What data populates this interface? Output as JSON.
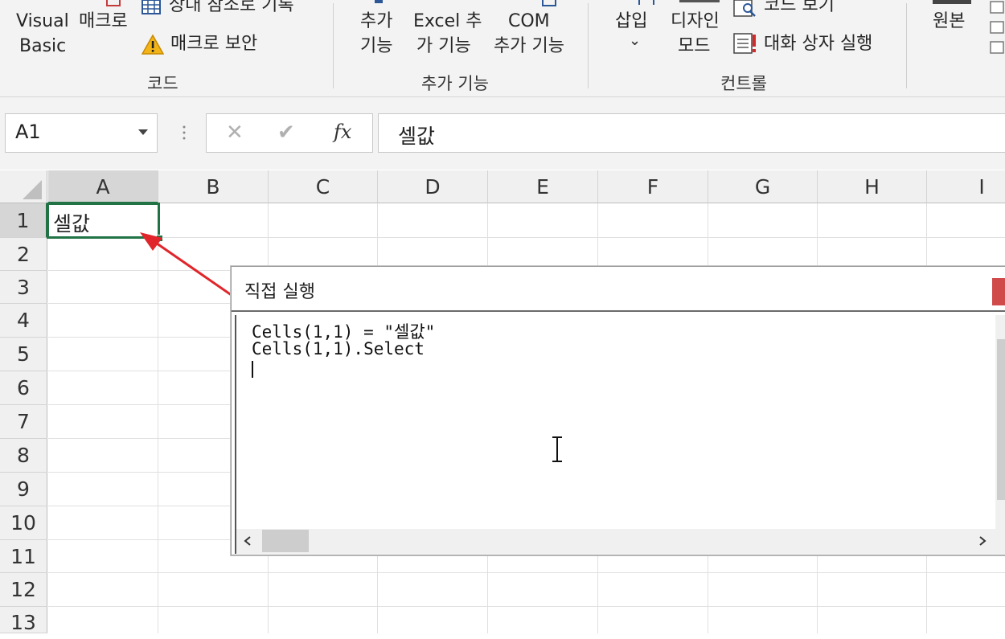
{
  "ribbon": {
    "code_group": {
      "vb_line1": "Visual",
      "vb_line2": "Basic",
      "macro": "매크로",
      "relative_ref": "상대 참조로 기록",
      "macro_security": "매크로 보안",
      "label": "코드"
    },
    "addins_group": {
      "addins_line1": "추가",
      "addins_line2": "기능",
      "excel_addins_line1": "Excel 추",
      "excel_addins_line2": "가 기능",
      "com_line1": "COM",
      "com_line2": "추가 기능",
      "label": "추가 기능"
    },
    "controls_group": {
      "insert": "삽입",
      "insert_arrow": "⌄",
      "design_line1": "디자인",
      "design_line2": "모드",
      "view_code": "코드 보기",
      "run_dialog": "대화 상자 실행",
      "label": "컨트롤"
    },
    "xml_group": {
      "source": "원본"
    }
  },
  "formula_bar": {
    "name_box": "A1",
    "cancel_glyph": "✕",
    "enter_glyph": "✔",
    "fx_glyph": "fx",
    "value": "셀값"
  },
  "grid": {
    "columns": [
      "A",
      "B",
      "C",
      "D",
      "E",
      "F",
      "G",
      "H",
      "I"
    ],
    "rows": [
      "1",
      "2",
      "3",
      "4",
      "5",
      "6",
      "7",
      "8",
      "9",
      "10",
      "11",
      "12",
      "13"
    ],
    "a1_value": "셀값",
    "selected_cell": "A1"
  },
  "immediate_window": {
    "title": "직접 실행",
    "lines": [
      "Cells(1,1) = \"셀값\"",
      "Cells(1,1).Select"
    ]
  },
  "colors": {
    "selection": "#217346",
    "arrow": "#e0262b",
    "close_button": "#d04a4a"
  }
}
